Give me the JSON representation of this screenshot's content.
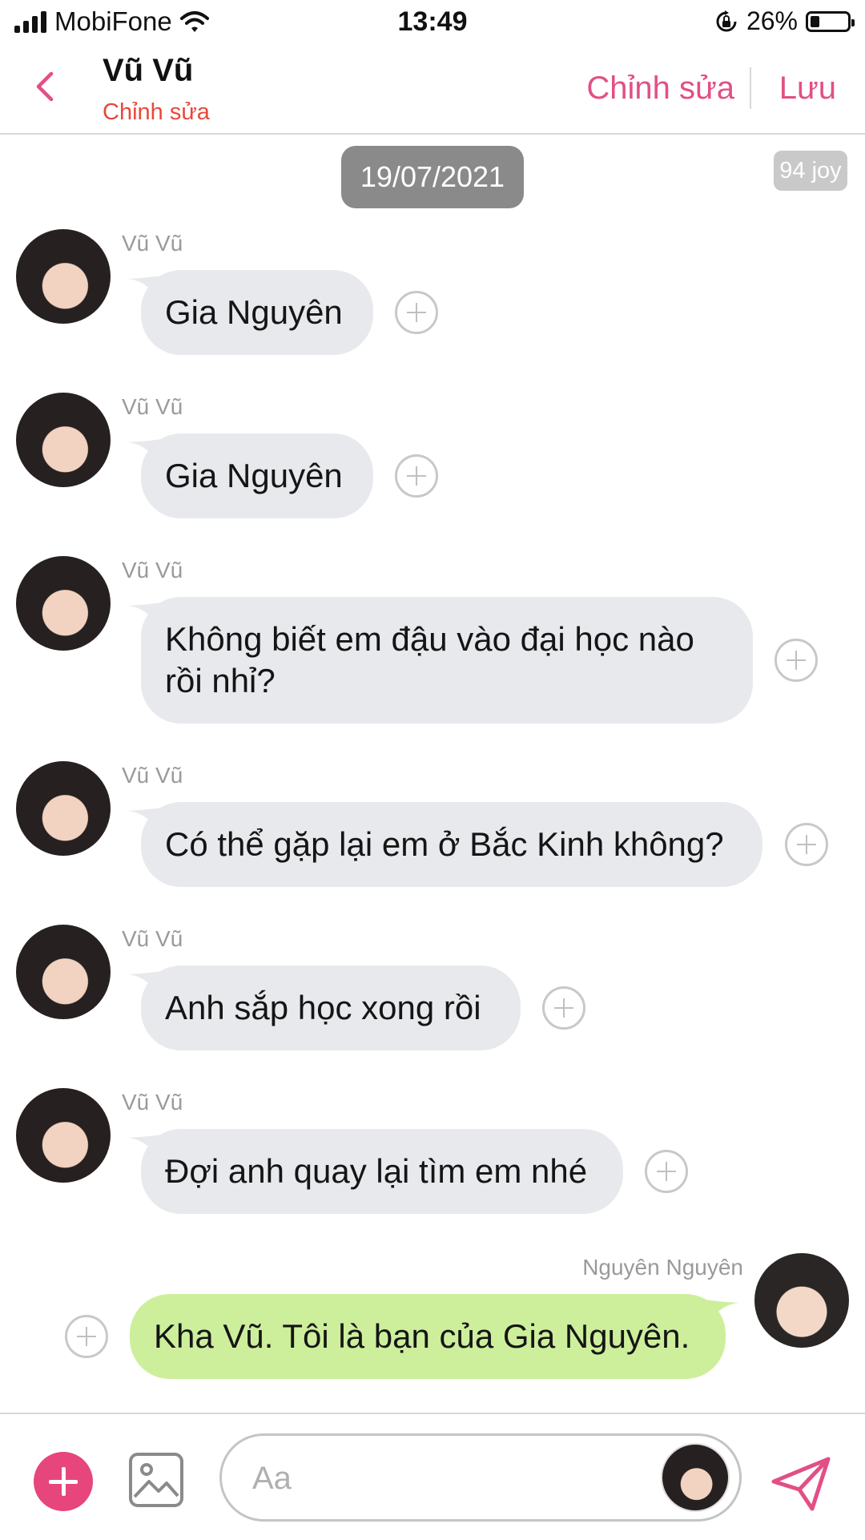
{
  "status_bar": {
    "carrier": "MobiFone",
    "time": "13:49",
    "battery": "26%",
    "battery_level": 0.26
  },
  "header": {
    "title": "Vũ Vũ",
    "subtitle": "Chỉnh sửa",
    "edit_label": "Chỉnh sửa",
    "save_label": "Lưu"
  },
  "date_label": "19/07/2021",
  "joy_label": "94 joy",
  "messages": [
    {
      "sender": "Vũ Vũ",
      "text": "Gia Nguyên"
    },
    {
      "sender": "Vũ Vũ",
      "text": "Gia Nguyên"
    },
    {
      "sender": "Vũ Vũ",
      "text": "Không biết em đậu vào đại học nào rồi nhỉ?"
    },
    {
      "sender": "Vũ Vũ",
      "text": "Có thể gặp lại em ở Bắc Kinh không?"
    },
    {
      "sender": "Vũ Vũ",
      "text": "Anh sắp học xong rồi"
    },
    {
      "sender": "Vũ Vũ",
      "text": "Đợi anh quay lại tìm em nhé"
    },
    {
      "sender": "Nguyên Nguyên",
      "text": "Kha Vũ. Tôi là bạn của Gia Nguyên."
    }
  ],
  "composer": {
    "placeholder": "Aa"
  },
  "icons": {
    "back": "chevron-left-icon",
    "add": "plus-circle-icon",
    "image": "image-icon",
    "send": "paper-plane-icon",
    "message_action": "plus-icon"
  },
  "colors": {
    "accent": "#e24f86",
    "subtitle": "#e8483b",
    "incoming_bubble": "#e7e9ec",
    "outgoing_bubble": "#cdef9c",
    "date_pill": "#8a8a8a"
  }
}
